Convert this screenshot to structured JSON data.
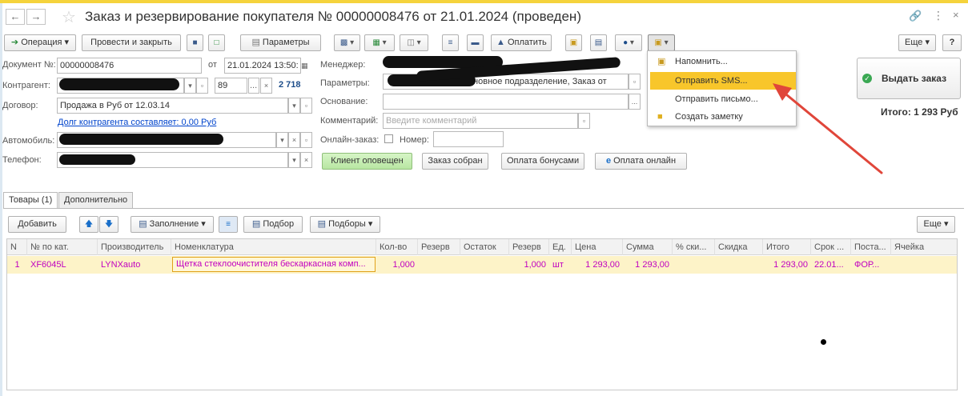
{
  "window": {
    "title": "Заказ и резервирование покупателя № 00000008476 от 21.01.2024 (проведен)"
  },
  "toolbar": {
    "operation": "Операция",
    "post_close": "Провести и закрыть",
    "params": "Параметры",
    "pay": "Оплатить",
    "more": "Еще",
    "help": "?"
  },
  "dropdown_menu": {
    "items": [
      "Напомнить...",
      "Отправить SMS...",
      "Отправить письмо...",
      "Создать заметку"
    ],
    "highlighted": "Отправить SMS..."
  },
  "form": {
    "doc_number_label": "Документ №:",
    "doc_number": "00000008476",
    "date_label": "от",
    "date": "21.01.2024 13:50:",
    "counterparty_label": "Контрагент:",
    "counterparty_code": "89",
    "counterparty_amount": "2 718",
    "contract_label": "Договор:",
    "contract": "Продажа в Руб от 12.03.14",
    "debt_link": "Долг контрагента составляет: 0,00 Руб",
    "car_label": "Автомобиль:",
    "phone_label": "Телефон:",
    "manager_label": "Менеджер:",
    "params_label": "Параметры:",
    "params_value": "Основное подразделение, Заказ от",
    "basis_label": "Основание:",
    "comment_label": "Комментарий:",
    "comment_placeholder": "Введите комментарий",
    "online_order_label": "Онлайн-заказ:",
    "number_label": "Номер:"
  },
  "actions": {
    "client_notified": "Клиент оповещен",
    "order_assembled": "Заказ собран",
    "bonus_payment": "Оплата бонусами",
    "online_payment": "Оплата онлайн"
  },
  "right_panel": {
    "issue_order": "Выдать заказ",
    "total": "Итого: 1 293 Руб"
  },
  "tabs": {
    "goods": "Товары (1)",
    "extra": "Дополнительно"
  },
  "table_toolbar": {
    "add": "Добавить",
    "fill": "Заполнение",
    "selection": "Подбор",
    "selections": "Подборы",
    "more": "Еще"
  },
  "table": {
    "columns": [
      "N",
      "№ по кат.",
      "Производитель",
      "Номенклатура",
      "Кол-во",
      "Резерв",
      "Остаток",
      "Резерв",
      "Ед.",
      "Цена",
      "Сумма",
      "% ски...",
      "Скидка",
      "Итого",
      "Срок ...",
      "Поста...",
      "Ячейка"
    ],
    "rows": [
      [
        "1",
        "XF6045L",
        "LYNXauto",
        "Щетка стеклоочистителя бескаркасная комп...",
        "1,000",
        "",
        "",
        "1,000",
        "шт",
        "1 293,00",
        "1 293,00",
        "",
        "",
        "1 293,00",
        "22.01...",
        "ФОР...",
        ""
      ]
    ]
  },
  "colors": {
    "accent_yellow": "#f8c62b",
    "green_button": "#c8efb5",
    "link_blue": "#0044cc",
    "row_text": "#c000c0",
    "arrow_red": "#e0463a"
  }
}
